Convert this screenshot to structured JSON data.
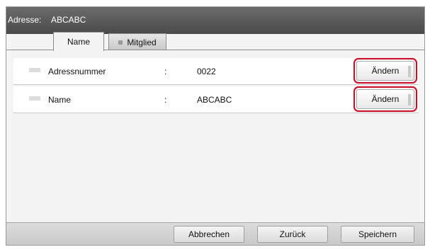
{
  "header": {
    "address_label": "Adresse:",
    "address_value": "ABCABC"
  },
  "tabs": [
    {
      "label": "Name",
      "active": true
    },
    {
      "label": "Mitglied",
      "active": false
    }
  ],
  "rows": [
    {
      "label": "Adressnummer",
      "separator": ":",
      "value": "0022",
      "button": "Ändern"
    },
    {
      "label": "Name",
      "separator": ":",
      "value": "ABCABC",
      "button": "Ändern"
    }
  ],
  "footer": {
    "cancel": "Abbrechen",
    "back": "Zurück",
    "save": "Speichern"
  },
  "colors": {
    "header_bg": "#555555",
    "highlight": "#e8001c"
  }
}
